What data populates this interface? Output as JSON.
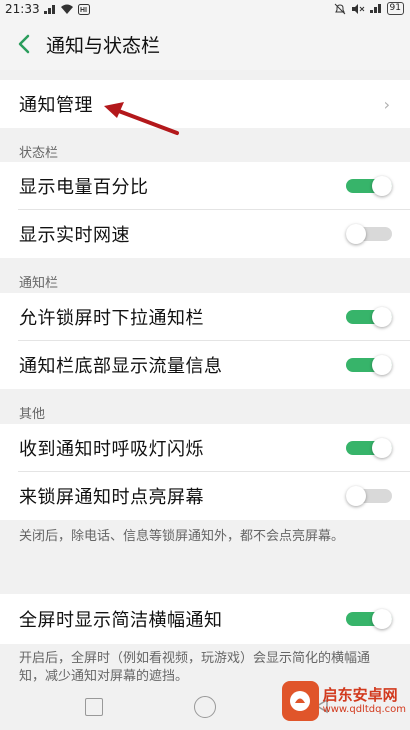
{
  "status_bar": {
    "time": "21:33",
    "battery": "91"
  },
  "header": {
    "title": "通知与状态栏"
  },
  "notification_management": {
    "label": "通知管理",
    "chevron": "›"
  },
  "sections": {
    "status_bar_label": "状态栏",
    "notification_bar_label": "通知栏",
    "other_label": "其他"
  },
  "settings": [
    {
      "label": "显示电量百分比",
      "enabled": true
    },
    {
      "label": "显示实时网速",
      "enabled": false
    },
    {
      "label": "允许锁屏时下拉通知栏",
      "enabled": true
    },
    {
      "label": "通知栏底部显示流量信息",
      "enabled": true
    },
    {
      "label": "收到通知时呼吸灯闪烁",
      "enabled": true
    },
    {
      "label": "来锁屏通知时点亮屏幕",
      "enabled": false
    },
    {
      "label": "全屏时显示简洁横幅通知",
      "enabled": true
    }
  ],
  "notes": {
    "lock_screen_note": "关闭后，除电话、信息等锁屏通知外，都不会点亮屏幕。",
    "banner_note": "开启后，全屏时（例如看视频，玩游戏）会显示简化的横幅通知，减少通知对屏幕的遮挡。"
  },
  "watermark": {
    "name": "启东安卓网",
    "url": "www.qdltdq.com"
  },
  "colors": {
    "toggle_on": "#37b46a",
    "toggle_off": "#d9d9d9",
    "accent_back": "#2a9d5c",
    "arrow": "#b3181b"
  },
  "icons": {
    "back": "chevron-left-icon",
    "row_chevron": "chevron-right-icon",
    "nav_recents": "square-icon",
    "nav_home": "circle-icon",
    "nav_back": "triangle-icon"
  }
}
